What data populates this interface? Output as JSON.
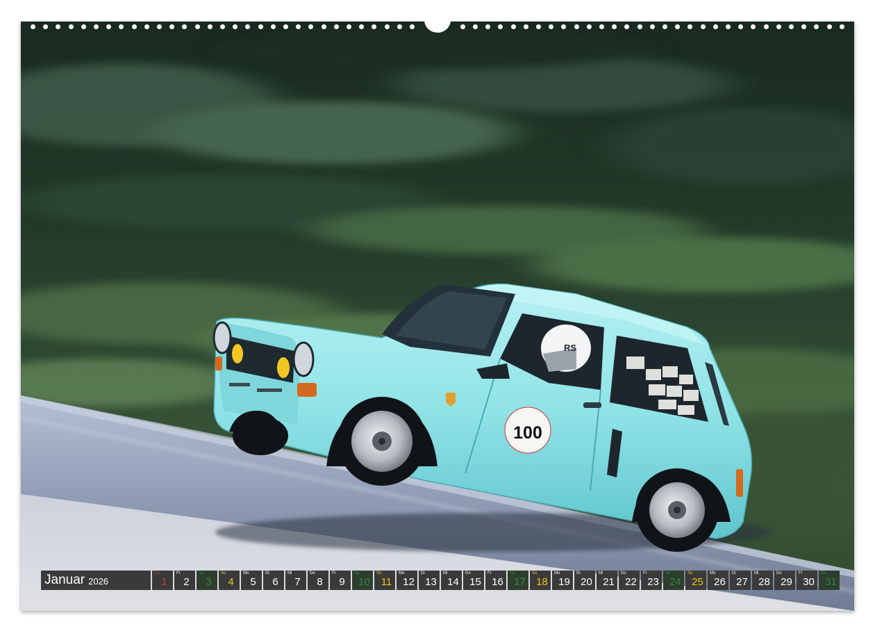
{
  "calendar": {
    "month": "Januar",
    "year": "2026",
    "days": [
      {
        "wd": "Do",
        "num": "1",
        "type": "hol"
      },
      {
        "wd": "Fr",
        "num": "2",
        "type": ""
      },
      {
        "wd": "Sa",
        "num": "3",
        "type": "sun"
      },
      {
        "wd": "So",
        "num": "4",
        "type": "sat"
      },
      {
        "wd": "Mo",
        "num": "5",
        "type": ""
      },
      {
        "wd": "Di",
        "num": "6",
        "type": ""
      },
      {
        "wd": "Mi",
        "num": "7",
        "type": ""
      },
      {
        "wd": "Do",
        "num": "8",
        "type": ""
      },
      {
        "wd": "Fr",
        "num": "9",
        "type": ""
      },
      {
        "wd": "Sa",
        "num": "10",
        "type": "sun"
      },
      {
        "wd": "So",
        "num": "11",
        "type": "sat"
      },
      {
        "wd": "Mo",
        "num": "12",
        "type": ""
      },
      {
        "wd": "Di",
        "num": "13",
        "type": ""
      },
      {
        "wd": "Mi",
        "num": "14",
        "type": ""
      },
      {
        "wd": "Do",
        "num": "15",
        "type": ""
      },
      {
        "wd": "Fr",
        "num": "16",
        "type": ""
      },
      {
        "wd": "Sa",
        "num": "17",
        "type": "sun"
      },
      {
        "wd": "So",
        "num": "18",
        "type": "sat"
      },
      {
        "wd": "Mo",
        "num": "19",
        "type": ""
      },
      {
        "wd": "Di",
        "num": "20",
        "type": ""
      },
      {
        "wd": "Mi",
        "num": "21",
        "type": ""
      },
      {
        "wd": "Do",
        "num": "22",
        "type": ""
      },
      {
        "wd": "Fr",
        "num": "23",
        "type": ""
      },
      {
        "wd": "Sa",
        "num": "24",
        "type": "sun"
      },
      {
        "wd": "So",
        "num": "25",
        "type": "sat"
      },
      {
        "wd": "Mo",
        "num": "26",
        "type": ""
      },
      {
        "wd": "Di",
        "num": "27",
        "type": ""
      },
      {
        "wd": "Mi",
        "num": "28",
        "type": ""
      },
      {
        "wd": "Do",
        "num": "29",
        "type": ""
      },
      {
        "wd": "Fr",
        "num": "30",
        "type": ""
      },
      {
        "wd": "Sa",
        "num": "31",
        "type": "sun"
      }
    ]
  },
  "photo": {
    "race_number": "100",
    "helmet_text": "RS",
    "car_color": "#8fe3e6",
    "colors": {
      "forest": "#1f3326",
      "grass": "#3d5a3a",
      "road": "#a8b4c8",
      "curb": "#e9e9ee"
    }
  }
}
